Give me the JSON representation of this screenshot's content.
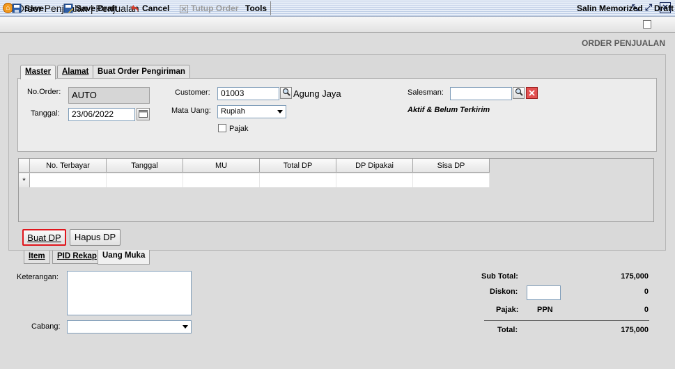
{
  "window": {
    "title": "Order Penjualan | Penjualan"
  },
  "toolbar": {
    "save": "Save",
    "save_draft": "Save Draft",
    "cancel": "Cancel",
    "tutup_order": "Tutup Order",
    "tools": "Tools",
    "salin_memorized": "Salin Memorized",
    "draft": "Draft"
  },
  "page_heading": "ORDER PENJUALAN",
  "tabs": {
    "master": "Master",
    "alamat": "Alamat",
    "buat_order_pengiriman": "Buat Order Pengiriman"
  },
  "form": {
    "no_order_label": "No.Order:",
    "no_order_value": "AUTO",
    "tanggal_label": "Tanggal:",
    "tanggal_value": "23/06/2022",
    "customer_label": "Customer:",
    "customer_value": "01003",
    "customer_name": "Agung Jaya",
    "mata_uang_label": "Mata Uang:",
    "mata_uang_value": "Rupiah",
    "pajak_label": "Pajak",
    "pajak_checked": false,
    "salesman_label": "Salesman:",
    "salesman_value": "",
    "status_text": "Aktif & Belum Terkirim"
  },
  "dp_table": {
    "row_marker": "*",
    "columns": [
      "No. Terbayar",
      "Tanggal",
      "MU",
      "Total DP",
      "DP Dipakai",
      "Sisa DP"
    ],
    "rows": []
  },
  "buttons": {
    "buat_dp": "Buat DP",
    "hapus_dp": "Hapus DP"
  },
  "bottom_tabs": {
    "item": "Item",
    "pid_rekap": "PID Rekap",
    "uang_muka": "Uang Muka"
  },
  "bottom": {
    "keterangan_label": "Keterangan:",
    "keterangan_value": "",
    "cabang_label": "Cabang:",
    "cabang_value": ""
  },
  "totals": {
    "sub_total_label": "Sub Total:",
    "sub_total_value": "175,000",
    "diskon_label": "Diskon:",
    "diskon_input": "",
    "diskon_value": "0",
    "pajak_label": "Pajak:",
    "pajak_type": "PPN",
    "pajak_value": "0",
    "total_label": "Total:",
    "total_value": "175,000"
  },
  "colors": {
    "highlight": "#e0161c",
    "field_border": "#7f9db9"
  }
}
